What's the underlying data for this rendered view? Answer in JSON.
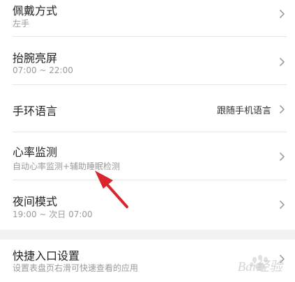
{
  "settings": [
    {
      "title": "佩戴方式",
      "subtitle": "左手",
      "value": ""
    },
    {
      "title": "抬腕亮屏",
      "subtitle": "07:00 ~ 22:00",
      "value": ""
    },
    {
      "title": "手环语言",
      "subtitle": "",
      "value": "跟随手机语言"
    },
    {
      "title": "心率监测",
      "subtitle": "自动心率监测+辅助睡眠检测",
      "value": ""
    },
    {
      "title": "夜间模式",
      "subtitle": "19:00 ~ 次日 07:00",
      "value": ""
    },
    {
      "title": "快捷入口设置",
      "subtitle": "设置表盘页右滑可快速查看的应用",
      "value": ""
    }
  ],
  "icons": {
    "row_chevron": "chevron-right-icon",
    "annotation": "red-arrow-icon"
  },
  "colors": {
    "annotation_arrow": "#d9262c",
    "section_gap": "#f2f2f2"
  },
  "watermark": {
    "text": "Bai经验"
  }
}
